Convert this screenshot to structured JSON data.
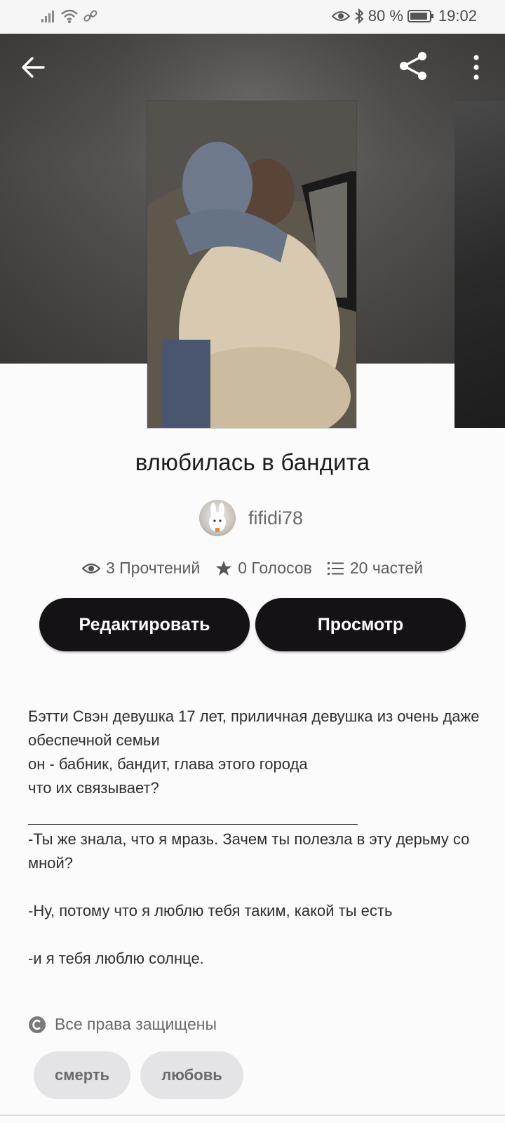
{
  "status_bar": {
    "battery": "80 %",
    "time": "19:02"
  },
  "story": {
    "title": "влюбилась в бандита",
    "author": "fifidi78",
    "stats": {
      "reads": "3 Прочтений",
      "votes": "0 Голосов",
      "parts": "20 частей"
    }
  },
  "actions": {
    "edit_label": "Редактировать",
    "preview_label": "Просмотр"
  },
  "description": {
    "lines_1": [
      "Бэтти Свэн девушка 17 лет, приличная девушка из очень даже обеспечной семьи",
      "он - бабник, бандит, глава этого города",
      "что их связывает?"
    ],
    "quote_1": "-Ты же знала, что я мразь. Зачем ты полезла в эту дерьму со мной?",
    "quote_2": "-Ну, потому что я люблю тебя таким, какой ты есть",
    "quote_3": "-и я тебя люблю солнце."
  },
  "copyright": "Все права защищены",
  "tags": [
    "смерть",
    "любовь"
  ],
  "colors": {
    "button_bg": "#141214",
    "tag_bg": "#e4e3e5",
    "accent_text": "#1d1b1d"
  }
}
